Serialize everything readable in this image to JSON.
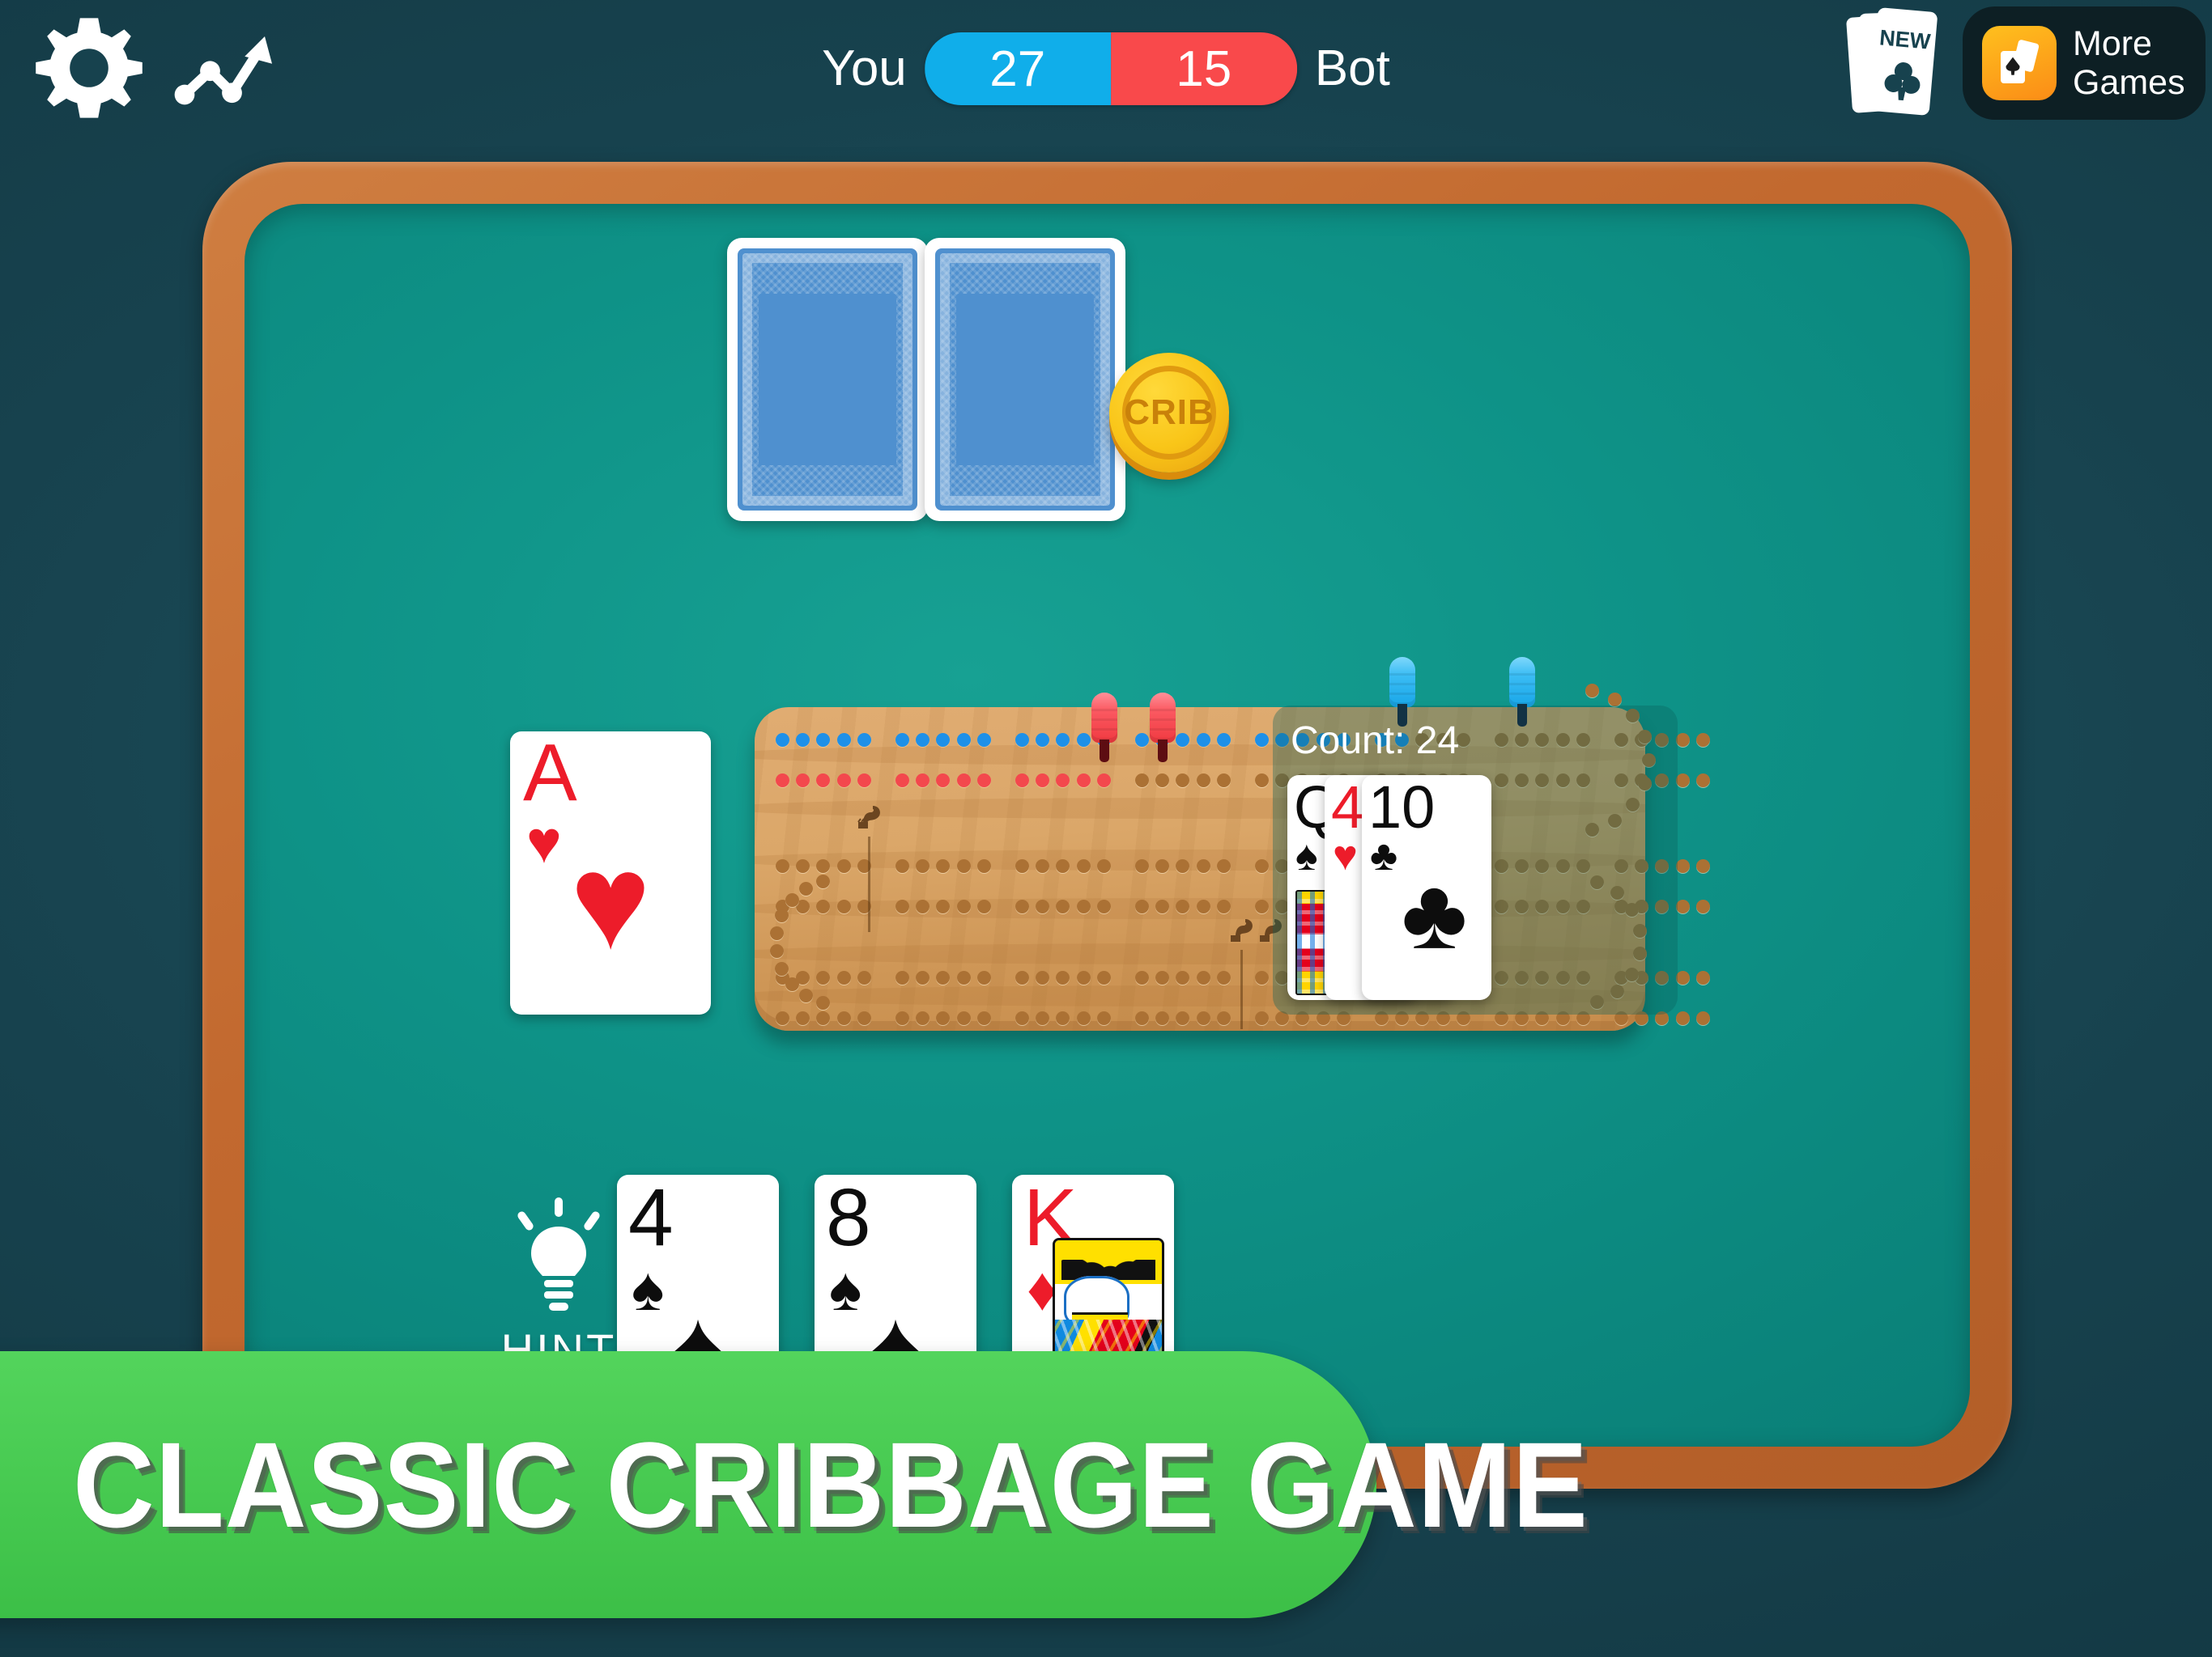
{
  "topbar": {
    "settings_icon": "gear-icon",
    "stats_icon": "trending-up-chart-icon",
    "new_badge_label": "NEW",
    "new_cards_icon": "new-cards-stack-icon",
    "more_games": {
      "line1": "More",
      "line2": "Games",
      "icon": "cards-app-icon"
    }
  },
  "score": {
    "you_label": "You",
    "you_score": "27",
    "bot_score": "15",
    "bot_label": "Bot",
    "you_color": "#10aeea",
    "bot_color": "#f9494b"
  },
  "table": {
    "rail_color": "#c2692f",
    "felt_color": "#0e9287"
  },
  "deck": {
    "card_back_1": "card-back",
    "card_back_2": "card-back",
    "crib_token_label": "CRIB"
  },
  "starter": {
    "rank": "A",
    "suit": "♥",
    "color": "red",
    "suit_name": "hearts"
  },
  "board": {
    "name": "cribbage-board",
    "wood_color": "#dba769",
    "pegs": [
      {
        "player": "you",
        "color": "#18a6e8",
        "track": "top",
        "hole": 26
      },
      {
        "player": "you",
        "color": "#18a6e8",
        "track": "top",
        "hole": 31
      },
      {
        "player": "bot",
        "color": "#f03940",
        "track": "top",
        "hole": 14
      },
      {
        "player": "bot",
        "color": "#f03940",
        "track": "top",
        "hole": 16
      }
    ],
    "you_filled_holes": 27,
    "bot_filled_holes": 15
  },
  "count_panel": {
    "label": "Count: 24",
    "cards": [
      {
        "rank": "Q",
        "suit": "♠",
        "color": "black",
        "suit_name": "spades"
      },
      {
        "rank": "4",
        "suit": "♥",
        "color": "red",
        "suit_name": "hearts"
      },
      {
        "rank": "10",
        "suit": "♣",
        "color": "black",
        "suit_name": "clubs"
      }
    ]
  },
  "hand": {
    "hint_label": "HINT",
    "hint_icon": "lightbulb-icon",
    "cards": [
      {
        "rank": "4",
        "suit": "♠",
        "color": "black",
        "suit_name": "spades"
      },
      {
        "rank": "8",
        "suit": "♠",
        "color": "black",
        "suit_name": "spades"
      },
      {
        "rank": "K",
        "suit": "♦",
        "color": "red",
        "suit_name": "diamonds"
      }
    ]
  },
  "banner": {
    "text": "CLASSIC CRIBBAGE GAME",
    "color": "#45c84f"
  }
}
